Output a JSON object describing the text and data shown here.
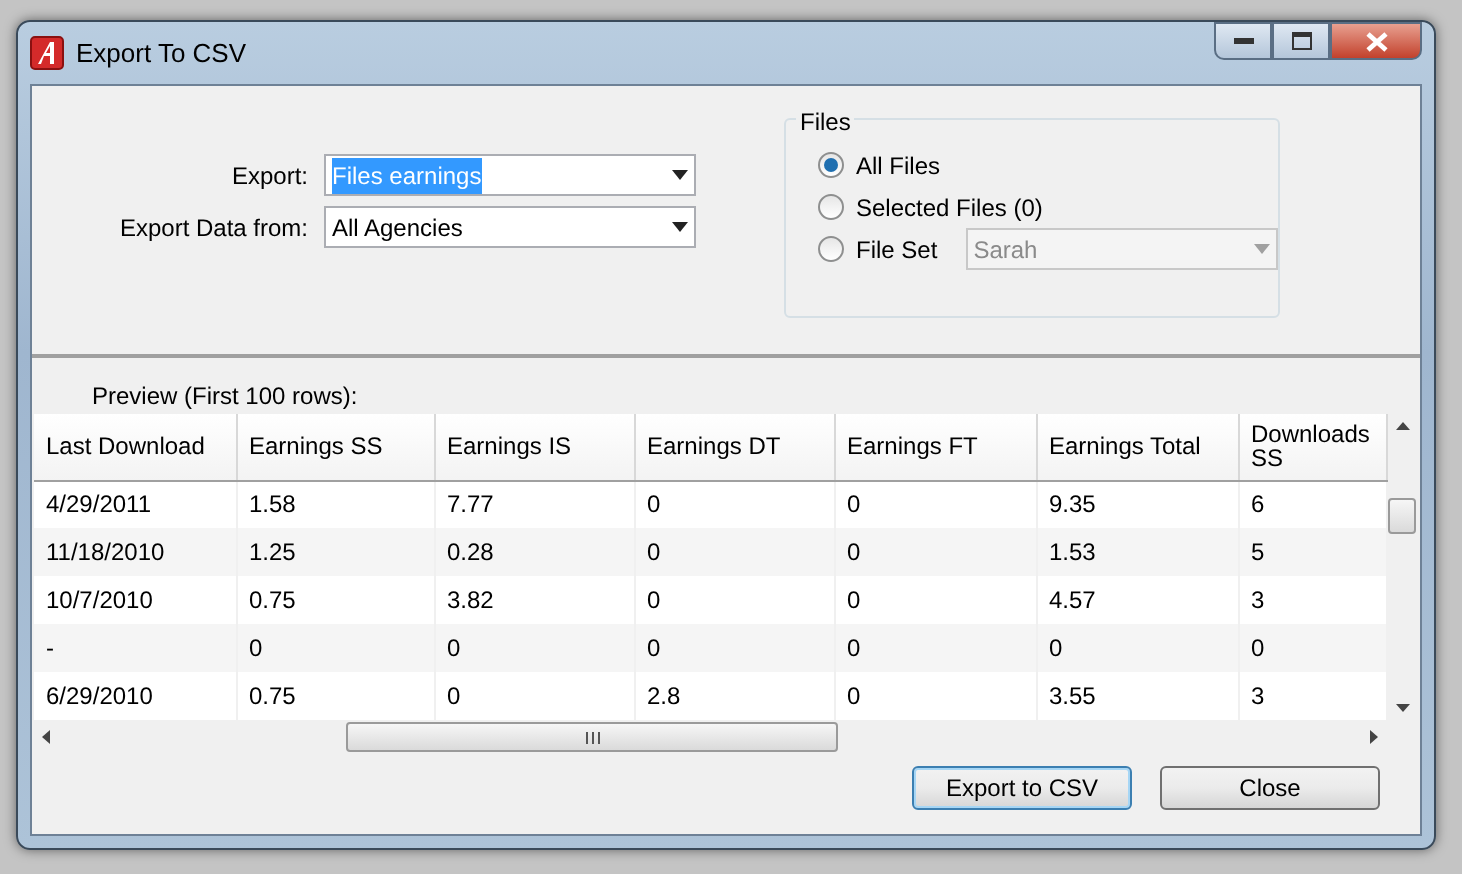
{
  "window": {
    "title": "Export To CSV"
  },
  "export_form": [
    {
      "label": "Export:",
      "value": "Files earnings",
      "text_selected": true
    },
    {
      "label": "Export Data from:",
      "value": "All Agencies",
      "text_selected": false
    }
  ],
  "files": {
    "title": "Files",
    "options": [
      {
        "label": "All Files",
        "selected": true
      },
      {
        "label": "Selected Files (0)",
        "selected": false
      },
      {
        "label": "File Set",
        "selected": false,
        "kind": "dropdown",
        "value": "Sarah",
        "disabled": true
      }
    ]
  },
  "preview": {
    "label": "Preview (First 100 rows):",
    "table": {
      "columns": [
        "Last Download",
        "Earnings SS",
        "Earnings IS",
        "Earnings DT",
        "Earnings FT",
        "Earnings Total",
        "Downloads SS"
      ],
      "rows": [
        [
          "4/29/2011",
          "1.58",
          "7.77",
          "0",
          "0",
          "9.35",
          "6"
        ],
        [
          "11/18/2010",
          "1.25",
          "0.28",
          "0",
          "0",
          "1.53",
          "5"
        ],
        [
          "10/7/2010",
          "0.75",
          "3.82",
          "0",
          "0",
          "4.57",
          "3"
        ],
        [
          "-",
          "0",
          "0",
          "0",
          "0",
          "0",
          "0"
        ],
        [
          "6/29/2010",
          "0.75",
          "0",
          "2.8",
          "0",
          "3.55",
          "3"
        ]
      ]
    }
  },
  "buttons": [
    {
      "label": "Export to CSV",
      "default": true
    },
    {
      "label": "Close",
      "default": false
    }
  ]
}
